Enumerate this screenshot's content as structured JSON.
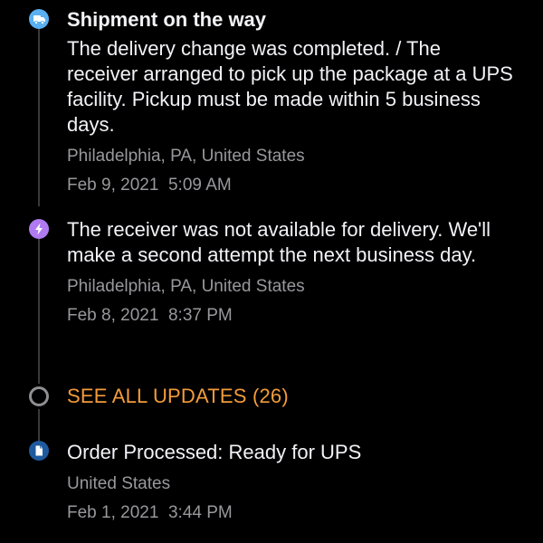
{
  "events": [
    {
      "title": "Shipment on the way",
      "description": "The delivery change was completed. / The receiver arranged to pick up the package at a UPS facility. Pickup must be made within 5 business days.",
      "location": "Philadelphia, PA, United States",
      "date": "Feb 9, 2021",
      "time": "5:09 AM",
      "icon": "truck-icon",
      "icon_color": "#5ab0f0"
    },
    {
      "description": "The receiver was not available for delivery. We'll make a second attempt the next business day.",
      "location": "Philadelphia, PA, United States",
      "date": "Feb 8, 2021",
      "time": "8:37 PM",
      "icon": "lightning-icon",
      "icon_color": "#b07af0"
    },
    {
      "title": "Order Processed: Ready for UPS",
      "location": "United States",
      "date": "Feb 1, 2021",
      "time": "3:44 PM",
      "icon": "document-icon",
      "icon_color": "#1e5b9e"
    }
  ],
  "see_all": {
    "label": "SEE ALL UPDATES (26)",
    "color": "#f39c3a",
    "icon": "ring-icon"
  }
}
